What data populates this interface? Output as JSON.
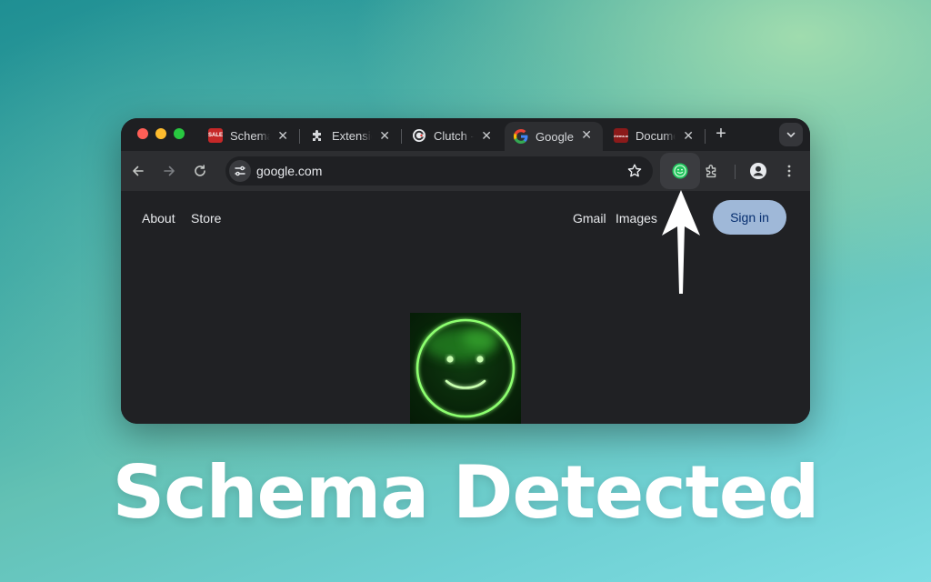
{
  "browser": {
    "tabs": [
      {
        "title": "Schema",
        "favicon": "schema-sale-favicon",
        "favicon_text": "SALE",
        "favicon_color": "#c62828",
        "active": false
      },
      {
        "title": "Extensions",
        "favicon": "puzzle-icon",
        "active": false
      },
      {
        "title": "Clutch -",
        "favicon": "clutch-favicon",
        "active": false
      },
      {
        "title": "Google",
        "favicon": "google-g-icon",
        "active": true
      },
      {
        "title": "Documents",
        "favicon": "schema-org-favicon",
        "favicon_text": "schema.org",
        "favicon_color": "#8b1a1a",
        "active": false
      }
    ],
    "tab_close_glyph": "✕",
    "new_tab_glyph": "+",
    "address": "google.com"
  },
  "page": {
    "nav_left": [
      "About",
      "Store"
    ],
    "nav_right": [
      "Gmail",
      "Images"
    ],
    "sign_in_label": "Sign in"
  },
  "headline": "Schema Detected",
  "colors": {
    "extension_green": "#22c55e",
    "smiley_glow": "#39ff14",
    "sign_in_bg": "#9fb8d8",
    "window_bg": "#202124"
  }
}
